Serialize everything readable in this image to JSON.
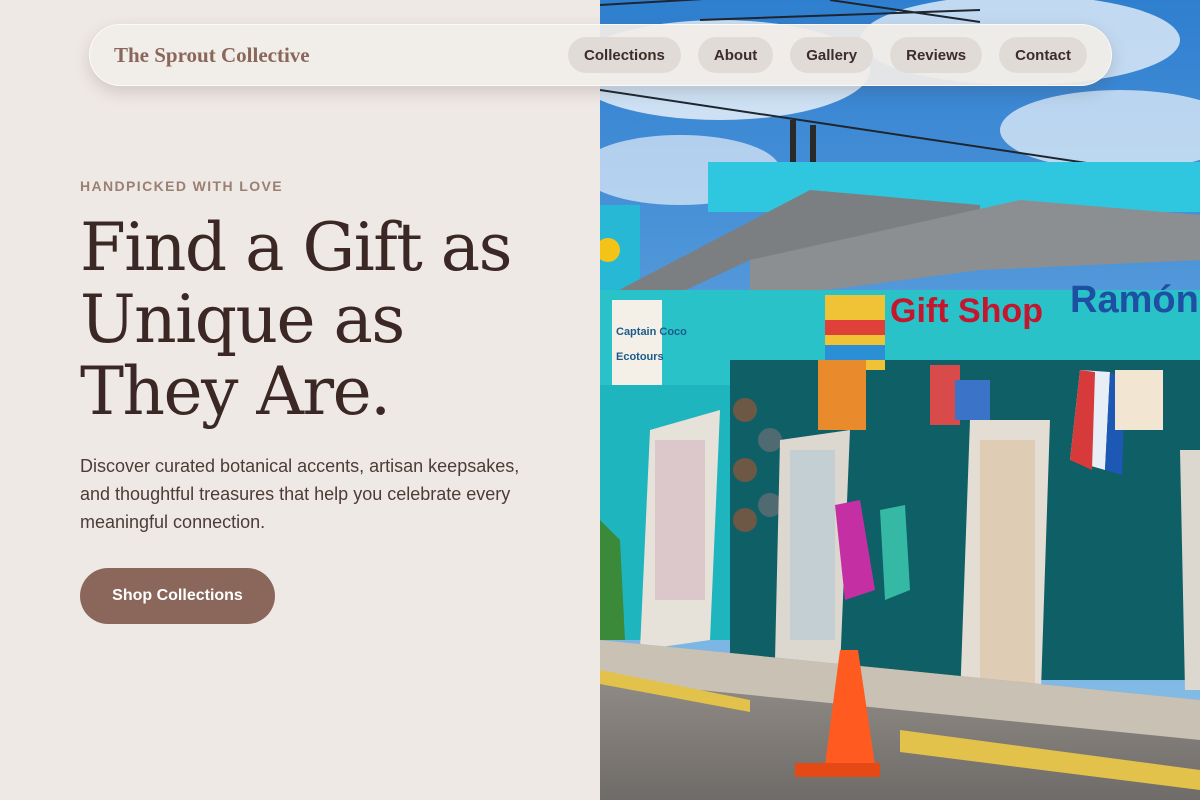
{
  "brand": {
    "name": "The Sprout Collective"
  },
  "nav": {
    "items": [
      {
        "label": "Collections"
      },
      {
        "label": "About"
      },
      {
        "label": "Gallery"
      },
      {
        "label": "Reviews"
      },
      {
        "label": "Contact"
      }
    ]
  },
  "hero": {
    "eyebrow": "HANDPICKED WITH LOVE",
    "headline": [
      "Find a Gift as",
      "Unique as",
      "They Are."
    ],
    "description": "Discover curated botanical accents, artisan keepsakes, and thoughtful treasures that help you celebrate every meaningful connection.",
    "cta_label": "Shop Collections"
  },
  "photo": {
    "signs": {
      "gift_shop": "Gift Shop",
      "ramon": "Ramón",
      "captain_coco": "Captain Coco",
      "ecotours": "Ecotours"
    }
  },
  "colors": {
    "background": "#efe9e6",
    "accent": "#8b675b",
    "headline": "#3b2824",
    "sky": "#4a90d0",
    "building_teal": "#1fb5bf"
  }
}
